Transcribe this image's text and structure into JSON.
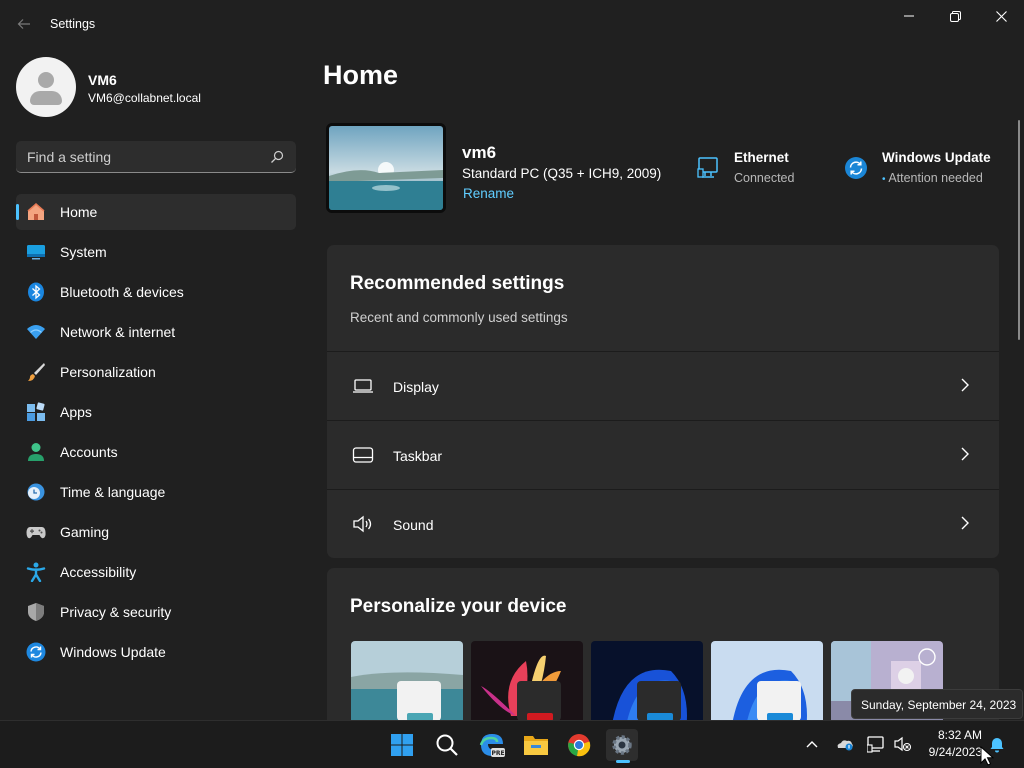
{
  "window": {
    "title": "Settings"
  },
  "profile": {
    "name": "VM6",
    "email": "VM6@collabnet.local"
  },
  "search": {
    "placeholder": "Find a setting"
  },
  "sidebar": {
    "items": [
      {
        "label": "Home",
        "icon": "home-icon",
        "active": true
      },
      {
        "label": "System",
        "icon": "system-icon"
      },
      {
        "label": "Bluetooth & devices",
        "icon": "bluetooth-icon"
      },
      {
        "label": "Network & internet",
        "icon": "wifi-icon"
      },
      {
        "label": "Personalization",
        "icon": "brush-icon"
      },
      {
        "label": "Apps",
        "icon": "apps-icon"
      },
      {
        "label": "Accounts",
        "icon": "accounts-icon"
      },
      {
        "label": "Time & language",
        "icon": "clock-globe-icon"
      },
      {
        "label": "Gaming",
        "icon": "gamepad-icon"
      },
      {
        "label": "Accessibility",
        "icon": "accessibility-icon"
      },
      {
        "label": "Privacy & security",
        "icon": "shield-icon"
      },
      {
        "label": "Windows Update",
        "icon": "update-icon"
      }
    ]
  },
  "main": {
    "title": "Home",
    "device": {
      "name": "vm6",
      "model": "Standard PC (Q35 + ICH9, 2009)",
      "rename_label": "Rename"
    },
    "ethernet": {
      "title": "Ethernet",
      "status": "Connected"
    },
    "windows_update": {
      "title": "Windows Update",
      "status": "Attention needed"
    },
    "recommended": {
      "title": "Recommended settings",
      "subtitle": "Recent and commonly used settings",
      "rows": [
        {
          "label": "Display",
          "icon": "laptop-icon"
        },
        {
          "label": "Taskbar",
          "icon": "taskbar-icon"
        },
        {
          "label": "Sound",
          "icon": "speaker-icon"
        }
      ]
    },
    "personalize": {
      "title": "Personalize your device"
    }
  },
  "taskbar": {
    "clock_time": "8:32 AM",
    "clock_date": "9/24/2023",
    "tooltip": "Sunday, September 24, 2023",
    "apps": [
      "start-icon",
      "search-icon",
      "edge-preview-icon",
      "file-explorer-icon",
      "chrome-icon",
      "settings-gear-icon"
    ]
  },
  "colors": {
    "accent": "#4cc2ff",
    "link": "#60cdff",
    "background": "#202020",
    "card": "#2b2b2b"
  }
}
